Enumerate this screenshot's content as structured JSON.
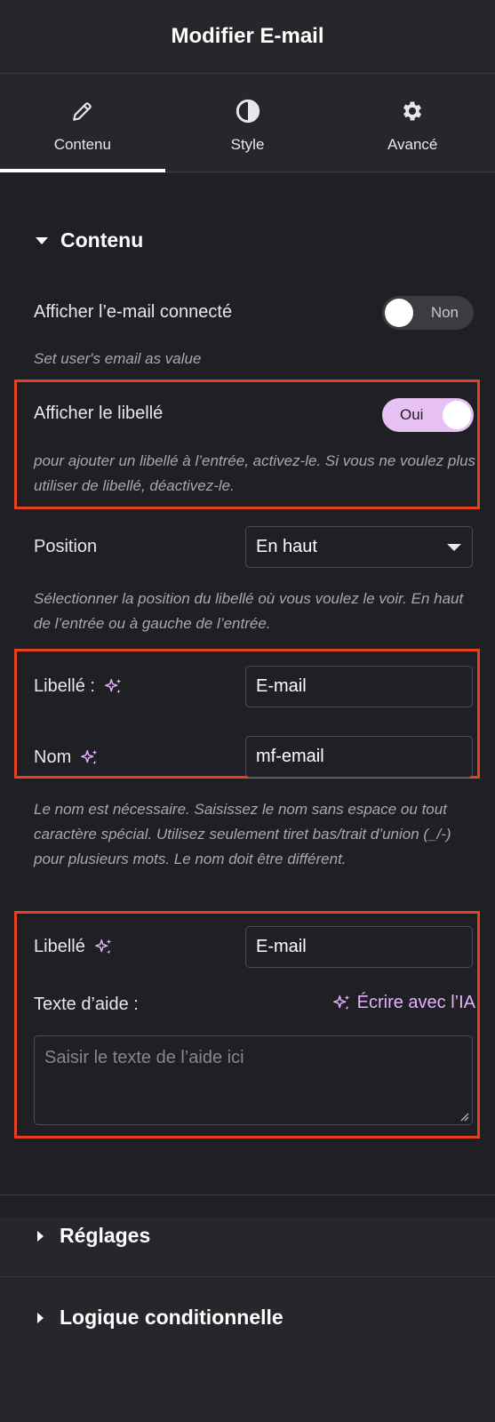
{
  "header": {
    "title": "Modifier E-mail"
  },
  "tabs": [
    {
      "label": "Contenu",
      "icon": "pencil-icon",
      "active": true
    },
    {
      "label": "Style",
      "icon": "contrast-icon",
      "active": false
    },
    {
      "label": "Avancé",
      "icon": "gear-icon",
      "active": false
    }
  ],
  "section": {
    "title": "Contenu"
  },
  "show_logged_email": {
    "label": "Afficher l’e-mail connecté",
    "toggle_text": "Non",
    "on": false,
    "help": "Set user's email as value"
  },
  "show_label": {
    "label": "Afficher le libellé",
    "toggle_text": "Oui",
    "on": true,
    "help": "pour ajouter un libellé à l’entrée, activez-le. Si vous ne voulez plus utiliser de libellé, déactivez-le."
  },
  "position": {
    "label": "Position",
    "value": "En haut",
    "help": "Sélectionner la position du libellé où vous voulez le voir. En haut de l’entrée ou à gauche de l’entrée."
  },
  "label_field": {
    "label": "Libellé :",
    "value": "E-mail"
  },
  "name_field": {
    "label": "Nom",
    "value": "mf-email",
    "help": "Le nom est nécessaire. Saisissez le nom sans espace ou tout caractère spécial. Utilisez seulement tiret bas/trait d’union (_/-) pour plusieurs mots. Le nom doit être différent."
  },
  "label_field_2": {
    "label": "Libellé",
    "value": "E-mail"
  },
  "help_text": {
    "label": "Texte d’aide :",
    "ai_link": "Écrire avec l’IA",
    "placeholder": "Saisir le texte de l’aide ici"
  },
  "collapsed_sections": [
    {
      "title": "Réglages"
    },
    {
      "title": "Logique conditionnelle"
    }
  ],
  "colors": {
    "accent": "#e7c1f3",
    "ai": "#e7b0ff",
    "highlight": "#e5401f",
    "panel": "#1f2024",
    "sidebar": "#26272b"
  }
}
